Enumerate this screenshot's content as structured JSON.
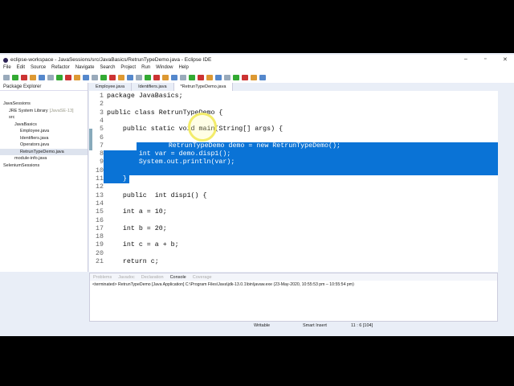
{
  "window": {
    "title": "eclipse-workspace - JavaSessions/src/JavaBasics/RetrunTypeDemo.java - Eclipse IDE"
  },
  "menu": [
    "File",
    "Edit",
    "Source",
    "Refactor",
    "Navigate",
    "Search",
    "Project",
    "Run",
    "Window",
    "Help"
  ],
  "explorer": {
    "title": "Package Explorer",
    "tree": [
      {
        "label": "JavaSessions",
        "depth": 0
      },
      {
        "label": "JRE System Library",
        "extra": "[JavaSE-13]",
        "depth": 1
      },
      {
        "label": "src",
        "depth": 1
      },
      {
        "label": "JavaBasics",
        "depth": 2
      },
      {
        "label": "Employee.java",
        "depth": 3
      },
      {
        "label": "Identifiers.java",
        "depth": 3
      },
      {
        "label": "Operators.java",
        "depth": 3
      },
      {
        "label": "RetrunTypeDemo.java",
        "depth": 3,
        "selected": true
      },
      {
        "label": "module-info.java",
        "depth": 2
      },
      {
        "label": "SeleniumSessions",
        "depth": 0
      }
    ]
  },
  "tabs": [
    "Employee.java",
    "Identifiers.java",
    "*RetrunTypeDemo.java"
  ],
  "code": [
    "package JavaBasics;",
    "",
    "public class RetrunTypeDemo {",
    "",
    "    public static void main(String[] args) {",
    "",
    "        RetrunTypeDemo demo = new RetrunTypeDemo();",
    "        int var = demo.disp1();",
    "        System.out.println(var);",
    "",
    "    }",
    "",
    "    public  int disp1() {",
    "",
    "    int a = 10;",
    "",
    "    int b = 20;",
    "",
    "    int c = a + b;",
    "",
    "    return c;"
  ],
  "selected_lines": [
    7,
    8,
    9,
    10,
    11
  ],
  "console": {
    "tabs": [
      "Problems",
      "Javadoc",
      "Declaration",
      "Console",
      "Coverage"
    ],
    "active": "Console",
    "terminated": "<terminated> RetrunTypeDemo [Java Application] C:\\Program Files\\Java\\jdk-13.0.1\\bin\\javaw.exe  (23-May-2020, 10:55:53 pm – 10:55:54 pm)"
  },
  "status": {
    "mode": "Writable",
    "insert": "Smart Insert",
    "position": "11 : 6 [104]"
  }
}
